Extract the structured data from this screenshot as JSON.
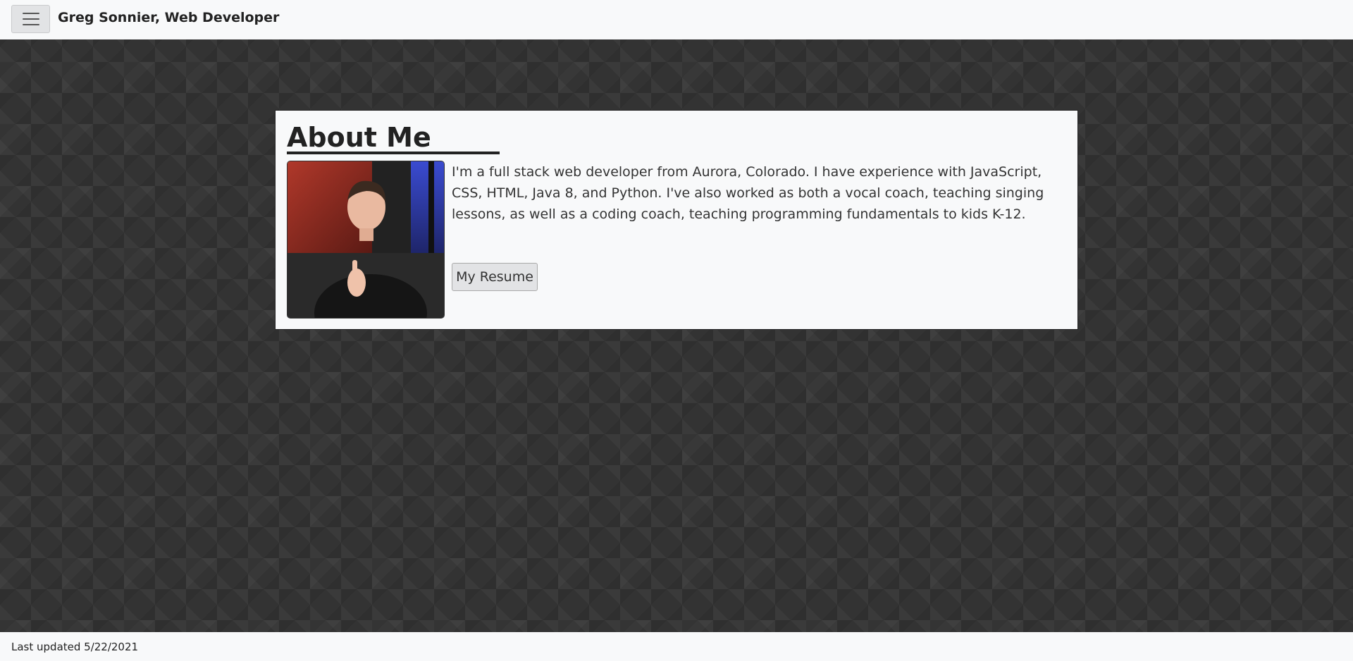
{
  "navbar": {
    "menu_icon": "hamburger-menu-icon",
    "brand": "Greg Sonnier, Web Developer"
  },
  "about": {
    "title": "About Me",
    "photo_alt": "Greg Sonnier portrait",
    "bio": "I'm a full stack web developer from Aurora, Colorado. I have experience with JavaScript, CSS, HTML, Java 8, and Python. I've also worked as both a vocal coach, teaching singing lessons, as well as a coding coach, teaching programming fundamentals to kids K-12.",
    "resume_button": "My Resume"
  },
  "footer": {
    "last_updated": "Last updated 5/22/2021"
  },
  "colors": {
    "navbar_bg": "#f8f9fa",
    "page_bg": "#333333",
    "card_bg": "#f8f9fa",
    "text": "#222222"
  }
}
